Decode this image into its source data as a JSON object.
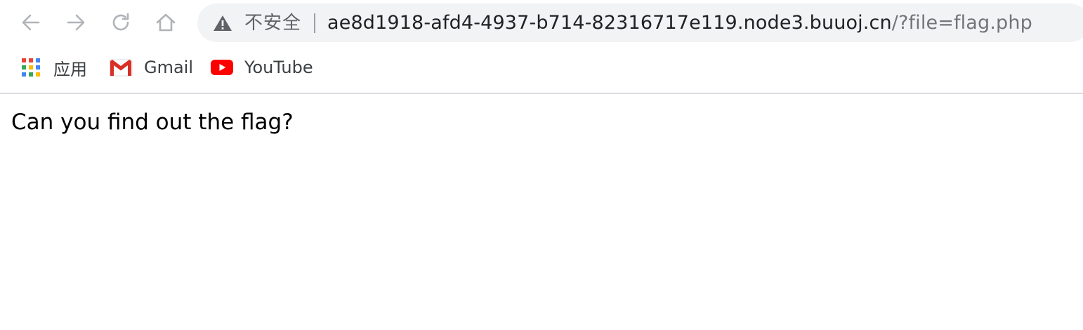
{
  "browser": {
    "security_label": "不安全",
    "url_host": "ae8d1918-afd4-4937-b714-82316717e119.node3.buuoj.cn",
    "url_rest": "/?file=flag.php",
    "nav_icons": [
      "back-arrow-icon",
      "forward-arrow-icon",
      "reload-icon",
      "home-icon"
    ]
  },
  "bookmarks": [
    {
      "label": "应用",
      "icon": "apps-grid-icon"
    },
    {
      "label": "Gmail",
      "icon": "gmail-icon"
    },
    {
      "label": "YouTube",
      "icon": "youtube-icon"
    }
  ],
  "page": {
    "body_text": "Can you find out the flag?"
  },
  "colors": {
    "omnibox_bg": "#f1f3f4",
    "nav_icon": "#b0b3b8",
    "youtube_red": "#ff0000",
    "gmail_red": "#d93025"
  }
}
